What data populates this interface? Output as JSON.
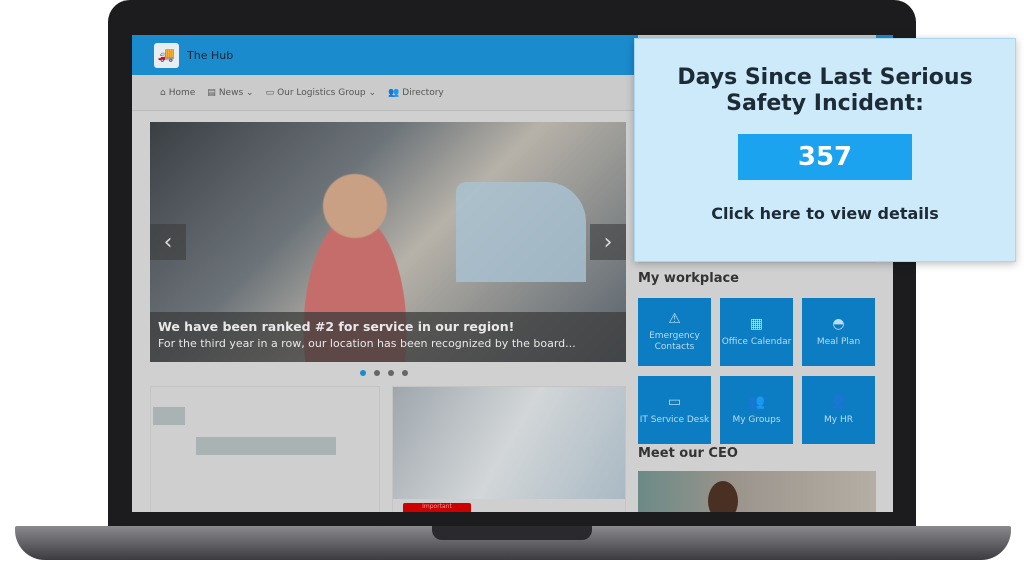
{
  "app": {
    "title": "The Hub",
    "logo_icon": "truck-icon",
    "accent": "#1a8cce"
  },
  "nav": [
    {
      "label": "Home",
      "icon": "home-icon"
    },
    {
      "label": "News",
      "icon": "newspaper-icon",
      "dropdown": true
    },
    {
      "label": "Our Logistics Group",
      "icon": "briefcase-icon",
      "dropdown": true
    },
    {
      "label": "Directory",
      "icon": "people-icon"
    }
  ],
  "hero": {
    "headline": "We have been ranked #2 for service in our region!",
    "summary": "For the third year in a row, our location has been recognized by the board...",
    "slides": 4,
    "active_slide": 1
  },
  "cards": [
    {
      "image": "people-with-banners"
    },
    {
      "image": "network-diagram",
      "badge": "Important"
    }
  ],
  "workplace": {
    "title": "My workplace",
    "tiles": [
      {
        "label": "Emergency Contacts",
        "icon": "warning-icon"
      },
      {
        "label": "Office Calendar",
        "icon": "calendar-icon"
      },
      {
        "label": "Meal Plan",
        "icon": "burger-icon"
      },
      {
        "label": "IT Service Desk",
        "icon": "monitor-icon"
      },
      {
        "label": "My Groups",
        "icon": "group-icon"
      },
      {
        "label": "My HR",
        "icon": "user-icon"
      }
    ]
  },
  "ceo": {
    "title": "Meet our CEO"
  },
  "popup": {
    "title": "Days Since Last Serious Safety Incident:",
    "value": "357",
    "link": "Click here to view details",
    "value_bg": "#1ba3ef",
    "bg": "#cdeafb"
  }
}
